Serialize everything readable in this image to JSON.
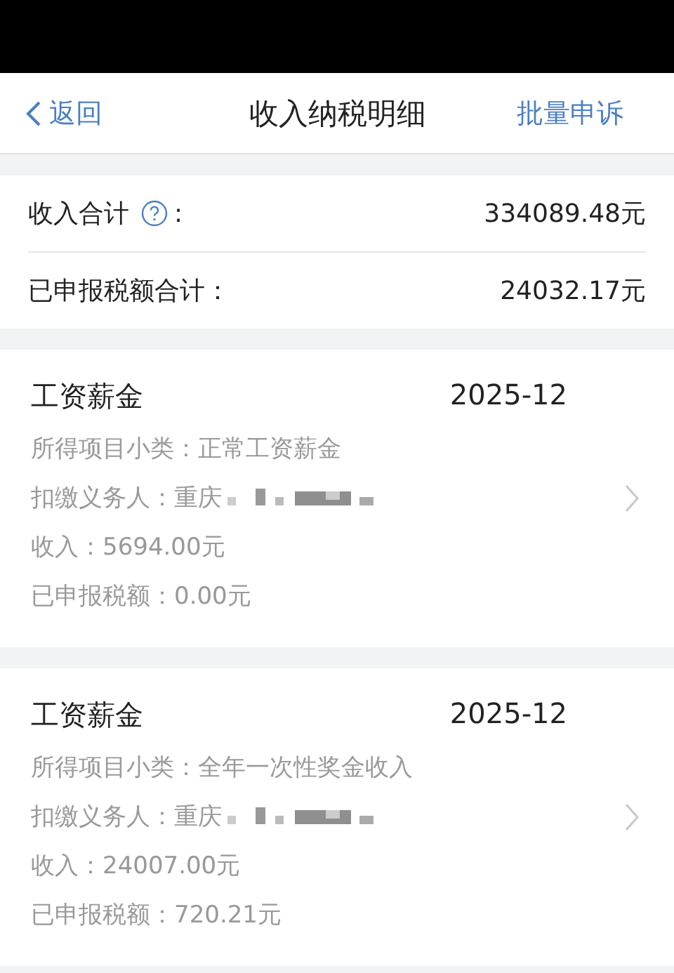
{
  "nav": {
    "back": "返回",
    "title": "收入纳税明细",
    "action": "批量申诉"
  },
  "summary": [
    {
      "label": "收入合计",
      "help": true,
      "colon": ":",
      "value": "334089.48元"
    },
    {
      "label": "已申报税额合计：",
      "help": false,
      "value": "24032.17元"
    }
  ],
  "records": [
    {
      "title": "工资薪金",
      "period": "2025-12",
      "lines": [
        {
          "text": "所得项目小类：正常工资薪金",
          "redacted": false
        },
        {
          "text": "扣缴义务人：重庆",
          "redacted": true
        },
        {
          "text": "收入：5694.00元",
          "redacted": false
        },
        {
          "text": "已申报税额：0.00元",
          "redacted": false
        }
      ]
    },
    {
      "title": "工资薪金",
      "period": "2025-12",
      "lines": [
        {
          "text": "所得项目小类：全年一次性奖金收入",
          "redacted": false
        },
        {
          "text": "扣缴义务人：重庆",
          "redacted": true
        },
        {
          "text": "收入：24007.00元",
          "redacted": false
        },
        {
          "text": "已申报税额：720.21元",
          "redacted": false
        }
      ]
    }
  ]
}
